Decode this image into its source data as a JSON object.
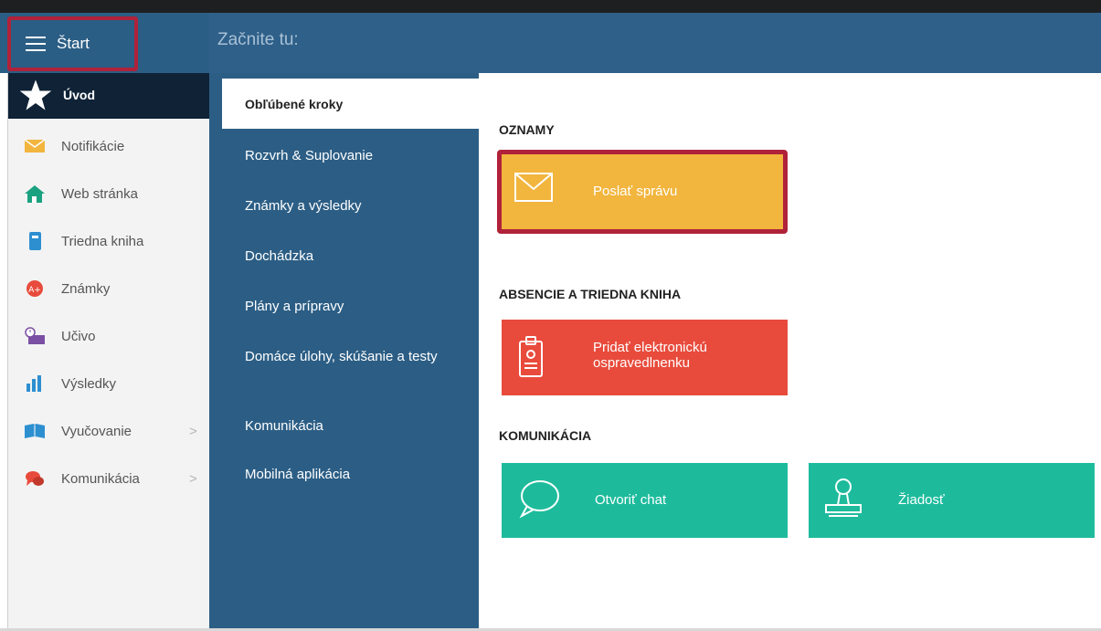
{
  "header": {
    "start_label": "Štart",
    "title": "Začnite tu:"
  },
  "sidebar": {
    "items": [
      {
        "label": "Úvod",
        "icon": "star-icon",
        "active": true
      },
      {
        "label": "Notifikácie",
        "icon": "envelope-icon"
      },
      {
        "label": "Web stránka",
        "icon": "home-icon"
      },
      {
        "label": "Triedna kniha",
        "icon": "book-icon"
      },
      {
        "label": "Známky",
        "icon": "grades-icon"
      },
      {
        "label": "Učivo",
        "icon": "clock-desk-icon"
      },
      {
        "label": "Výsledky",
        "icon": "bar-chart-icon"
      },
      {
        "label": "Vyučovanie",
        "icon": "open-book-icon",
        "chevron": ">"
      },
      {
        "label": "Komunikácia",
        "icon": "chat-bubbles-icon",
        "chevron": ">"
      }
    ]
  },
  "midnav": {
    "items": [
      {
        "label": "Obľúbené kroky",
        "active": true
      },
      {
        "label": "Rozvrh & Suplovanie"
      },
      {
        "label": "Známky a výsledky"
      },
      {
        "label": "Dochádzka"
      },
      {
        "label": "Plány a prípravy"
      },
      {
        "label": "Domáce úlohy, skúšanie a testy"
      },
      {
        "label": "Komunikácia"
      },
      {
        "label": "Mobilná aplikácia"
      }
    ]
  },
  "content": {
    "sections": [
      {
        "title": "OZNAMY",
        "tiles": [
          {
            "label": "Poslať správu",
            "icon": "envelope-icon",
            "color": "#f2b53d"
          }
        ]
      },
      {
        "title": "ABSENCIE A TRIEDNA KNIHA",
        "tiles": [
          {
            "label": "Pridať elektronickú ospravedlnenku",
            "icon": "document-icon",
            "color": "#e84b3c"
          }
        ]
      },
      {
        "title": "KOMUNIKÁCIA",
        "tiles": [
          {
            "label": "Otvoriť chat",
            "icon": "chat-bubble-icon",
            "color": "#1dbb9c"
          },
          {
            "label": "Žiadosť",
            "icon": "stamp-icon",
            "color": "#1dbb9c"
          }
        ]
      }
    ]
  },
  "colors": {
    "header": "#2f6089",
    "active_sidebar": "#0f2236",
    "highlight_border": "#b0223a"
  }
}
